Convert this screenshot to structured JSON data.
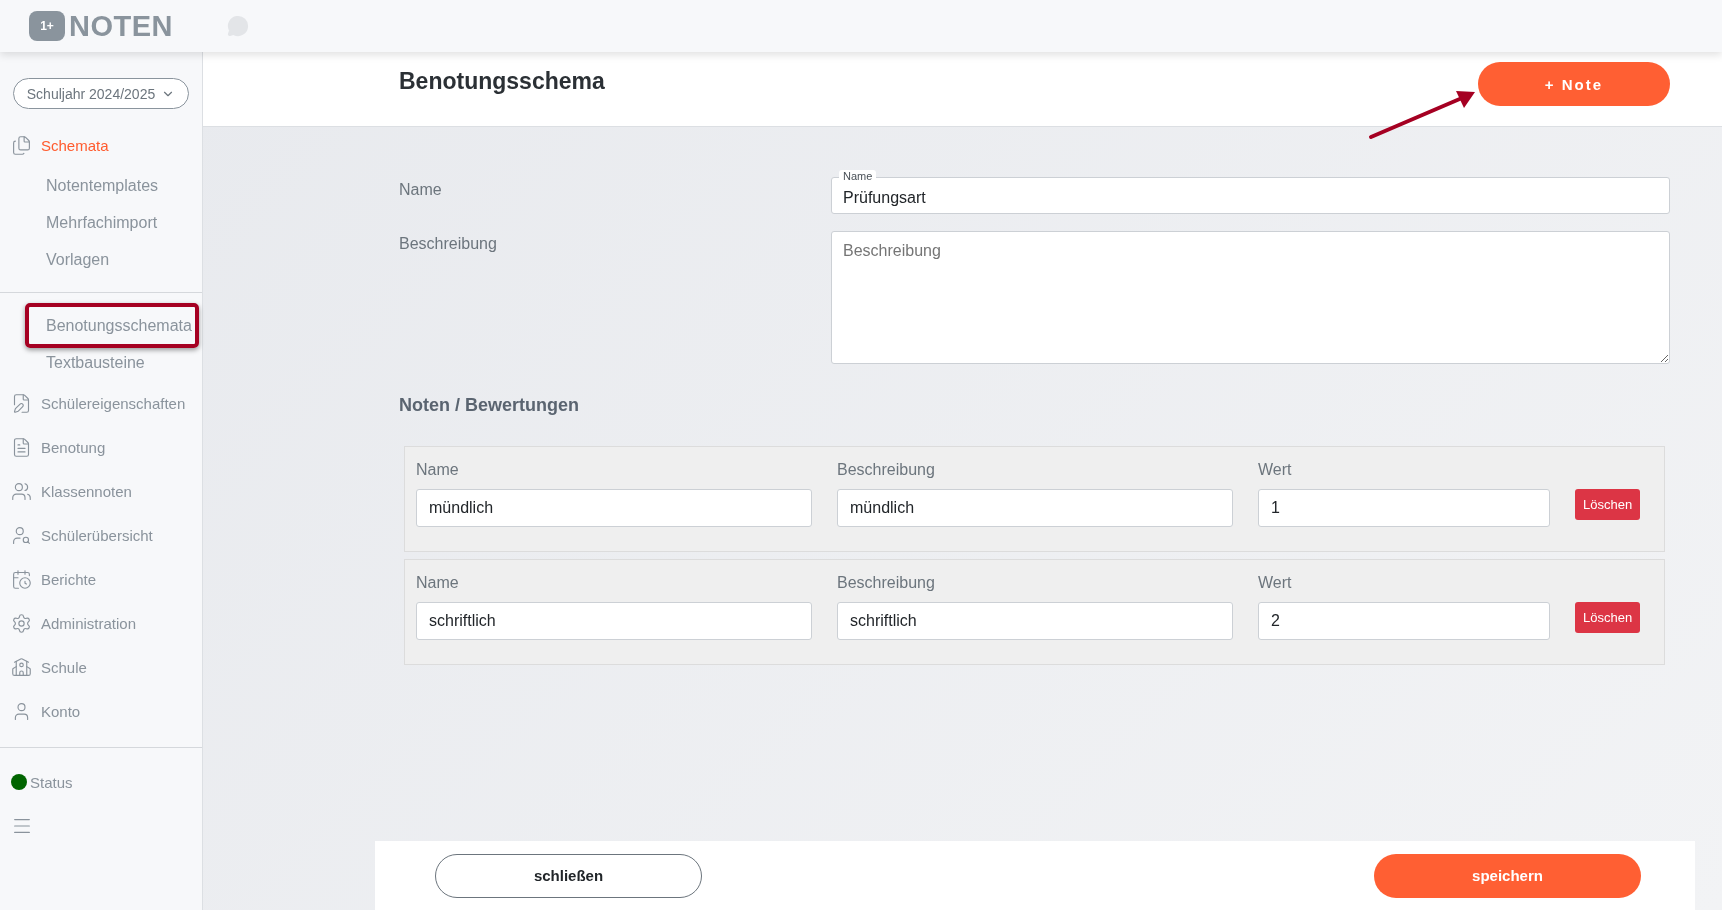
{
  "app": {
    "logo_badge": "1+",
    "logo_text": "NOTEN"
  },
  "sidebar": {
    "year_select": "Schuljahr 2024/2025",
    "groups": [
      {
        "items": [
          {
            "kind": "main",
            "label": "Schemata",
            "selected": true,
            "children": [
              {
                "kind": "sub",
                "label": "Notentemplates",
                "selected": false
              },
              {
                "kind": "sub",
                "label": "Mehrfachimport",
                "selected": false
              },
              {
                "kind": "sub",
                "label": "Vorlagen",
                "selected": false
              }
            ]
          }
        ]
      },
      {
        "items": [
          {
            "kind": "sub",
            "label": "Benotungsschemata",
            "selected": false,
            "annotated": true
          },
          {
            "kind": "sub",
            "label": "Textbausteine",
            "selected": false
          },
          {
            "kind": "main",
            "label": "Schülereigenschaften",
            "selected": false
          },
          {
            "kind": "main",
            "label": "Benotung",
            "selected": false
          },
          {
            "kind": "main",
            "label": "Klassennoten",
            "selected": false
          },
          {
            "kind": "main",
            "label": "Schülerübersicht",
            "selected": false
          },
          {
            "kind": "main",
            "label": "Berichte",
            "selected": false
          },
          {
            "kind": "main",
            "label": "Administration",
            "selected": false
          },
          {
            "kind": "main",
            "label": "Schule",
            "selected": false
          },
          {
            "kind": "main",
            "label": "Konto",
            "selected": false
          }
        ]
      }
    ],
    "status": {
      "label": "Status",
      "color": "#006400"
    }
  },
  "header": {
    "title": "Benotungsschema",
    "add_button": {
      "label": "+ Note",
      "annotated": true
    }
  },
  "form": {
    "name_label": "Name",
    "name_field": {
      "floating_label": "Name",
      "value": "Prüfungsart"
    },
    "description_label": "Beschreibung",
    "description_field": {
      "placeholder": "Beschreibung"
    },
    "section_title": "Noten / Bewertungen",
    "grades": [
      {
        "name_label": "Name",
        "name": "mündlich",
        "description_label": "Beschreibung",
        "description": "mündlich",
        "value_label": "Wert",
        "value": "1",
        "delete": "Löschen"
      },
      {
        "name_label": "Name",
        "name": "schriftlich",
        "description_label": "Beschreibung",
        "description": "schriftlich",
        "value_label": "Wert",
        "value": "2",
        "delete": "Löschen"
      }
    ]
  },
  "footer": {
    "close": "schließen",
    "save": "speichern"
  }
}
